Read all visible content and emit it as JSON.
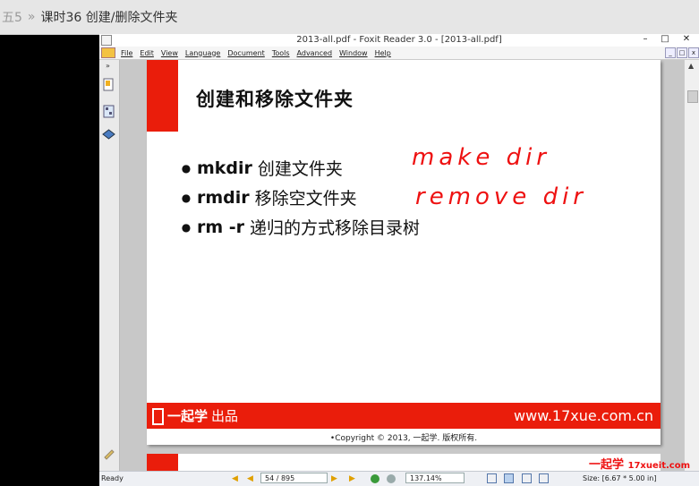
{
  "header": {
    "chapter_fragment": "五5",
    "separator": "»",
    "lesson_title": "课时36  创建/删除文件夹"
  },
  "window": {
    "title": "2013-all.pdf - Foxit Reader 3.0 - [2013-all.pdf]",
    "controls": [
      "–",
      "□",
      "✕"
    ]
  },
  "menu": [
    "File",
    "Edit",
    "View",
    "Language",
    "Document",
    "Tools",
    "Advanced",
    "Window",
    "Help"
  ],
  "mdi_controls": [
    "_",
    "□",
    "x"
  ],
  "slide": {
    "heading": "创建和移除文件夹",
    "bullets": [
      {
        "cmd": "mkdir",
        "desc": "创建文件夹"
      },
      {
        "cmd": "rmdir",
        "desc": "移除空文件夹"
      },
      {
        "cmd": "rm -r",
        "desc": "递归的方式移除目录树"
      }
    ],
    "annotations": [
      "make  dir",
      "remove  dir"
    ],
    "footer_logo": "一起学",
    "footer_logo_suffix": "出品",
    "footer_url": "www.17xue.com.cn",
    "copyright": "•Copyright © 2013, 一起学. 版权所有."
  },
  "status": {
    "ready": "Ready",
    "page": "54 / 895",
    "zoom": "137.14%",
    "size": "Size: [6.67 * 5.00 in]"
  },
  "watermark": {
    "logo": "一起学",
    "site": "17xueit.com"
  },
  "colors": {
    "brand_red": "#ea1d0b",
    "annotation_red": "#ee1111"
  }
}
